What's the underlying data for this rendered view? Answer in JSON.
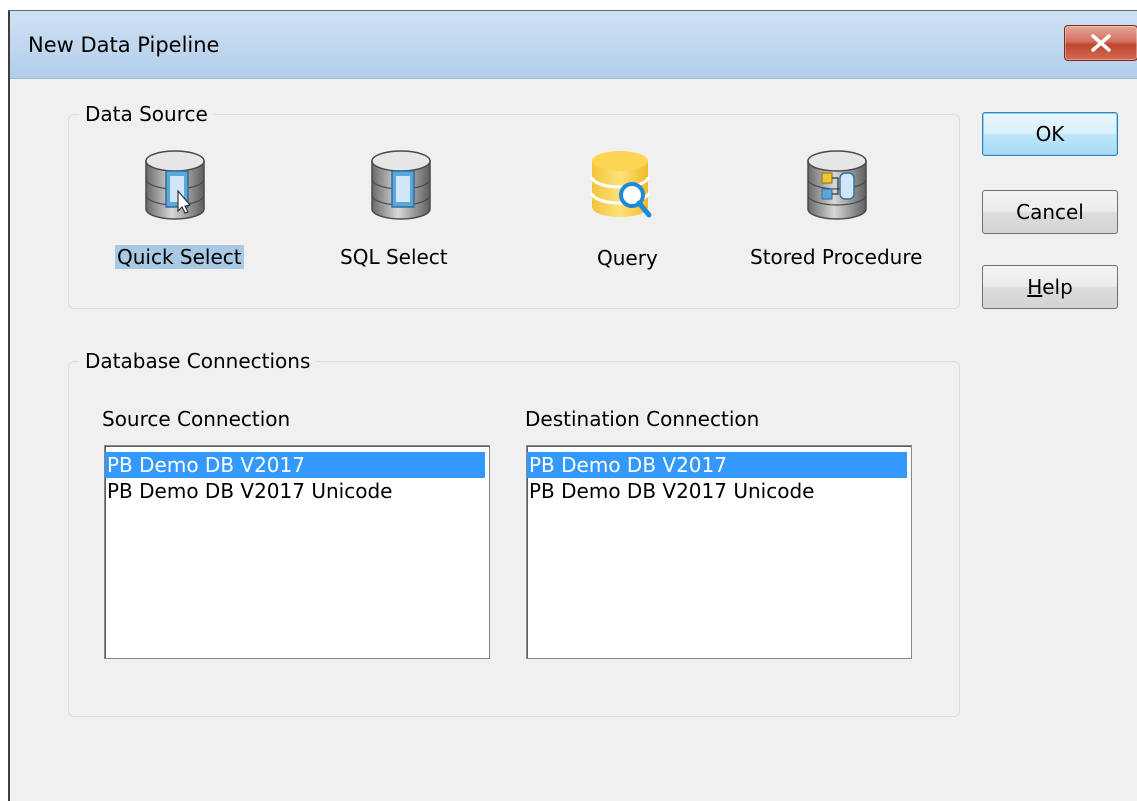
{
  "window": {
    "title": "New Data Pipeline"
  },
  "data_source": {
    "group_title": "Data Source",
    "items": [
      {
        "label": "Quick Select",
        "icon": "quick-select-db-icon",
        "selected": true
      },
      {
        "label": "SQL Select",
        "icon": "sql-select-db-icon",
        "selected": false
      },
      {
        "label": "Query",
        "icon": "query-db-icon",
        "selected": false
      },
      {
        "label": "Stored Procedure",
        "icon": "stored-procedure-db-icon",
        "selected": false
      }
    ]
  },
  "connections": {
    "group_title": "Database Connections",
    "source": {
      "label": "Source Connection",
      "items": [
        "PB Demo DB V2017",
        "PB Demo DB V2017 Unicode"
      ],
      "selected": "PB Demo DB V2017"
    },
    "destination": {
      "label": "Destination Connection",
      "items": [
        "PB Demo DB V2017",
        "PB Demo DB V2017 Unicode"
      ],
      "selected": "PB Demo DB V2017"
    }
  },
  "buttons": {
    "ok": "OK",
    "cancel": "Cancel",
    "help_mnemonic": "H",
    "help_rest": "elp"
  },
  "colors": {
    "selection": "#3399ff",
    "icon_selection": "#a9c8e4",
    "close_button": "#c04530"
  }
}
